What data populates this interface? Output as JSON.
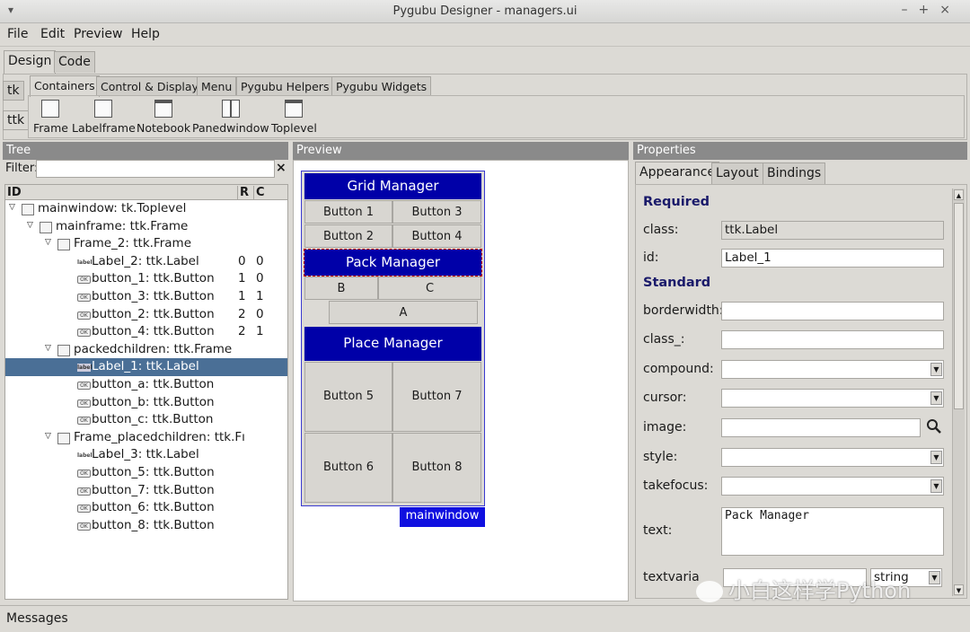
{
  "window": {
    "title": "Pygubu Designer - managers.ui",
    "controls": [
      "–",
      "+",
      "×"
    ]
  },
  "menu": [
    "File",
    "Edit",
    "Preview",
    "Help"
  ],
  "main_tabs": [
    "Design",
    "Code"
  ],
  "side_tabs": [
    "tk",
    "ttk"
  ],
  "palette_tabs": [
    "Containers",
    "Control & Display",
    "Menu",
    "Pygubu Helpers",
    "Pygubu Widgets"
  ],
  "palette_items": [
    "Frame",
    "Labelframe",
    "Notebook",
    "Panedwindow",
    "Toplevel"
  ],
  "panels": {
    "tree": "Tree",
    "preview": "Preview",
    "properties": "Properties"
  },
  "tree": {
    "filter_label": "Filter:",
    "filter_value": "",
    "clear": "×",
    "columns": {
      "id": "ID",
      "r": "R",
      "c": "C"
    },
    "rows": [
      {
        "label": "mainwindow: tk.Toplevel",
        "r": "",
        "c": "",
        "icon": "window-icon",
        "level": 0,
        "expander": "▽"
      },
      {
        "label": "mainframe: ttk.Frame",
        "r": "",
        "c": "",
        "icon": "frame-icon",
        "level": 1,
        "expander": "▽"
      },
      {
        "label": "Frame_2: ttk.Frame",
        "r": "",
        "c": "",
        "icon": "frame-icon",
        "level": 2,
        "expander": "▽"
      },
      {
        "label": "Label_2: ttk.Label",
        "r": "0",
        "c": "0",
        "icon": "label-icon",
        "level": 3,
        "expander": ""
      },
      {
        "label": "button_1: ttk.Button",
        "r": "1",
        "c": "0",
        "icon": "button-icon",
        "level": 3,
        "expander": ""
      },
      {
        "label": "button_3: ttk.Button",
        "r": "1",
        "c": "1",
        "icon": "button-icon",
        "level": 3,
        "expander": ""
      },
      {
        "label": "button_2: ttk.Button",
        "r": "2",
        "c": "0",
        "icon": "button-icon",
        "level": 3,
        "expander": ""
      },
      {
        "label": "button_4: ttk.Button",
        "r": "2",
        "c": "1",
        "icon": "button-icon",
        "level": 3,
        "expander": ""
      },
      {
        "label": "packedchildren: ttk.Frame",
        "r": "",
        "c": "",
        "icon": "frame-icon",
        "level": 2,
        "expander": "▽"
      },
      {
        "label": "Label_1: ttk.Label",
        "r": "",
        "c": "",
        "icon": "label-icon",
        "level": 3,
        "expander": "",
        "selected": true
      },
      {
        "label": "button_a: ttk.Button",
        "r": "",
        "c": "",
        "icon": "button-icon",
        "level": 3,
        "expander": ""
      },
      {
        "label": "button_b: ttk.Button",
        "r": "",
        "c": "",
        "icon": "button-icon",
        "level": 3,
        "expander": ""
      },
      {
        "label": "button_c: ttk.Button",
        "r": "",
        "c": "",
        "icon": "button-icon",
        "level": 3,
        "expander": ""
      },
      {
        "label": "Frame_placedchildren: ttk.Fı",
        "r": "",
        "c": "",
        "icon": "frame-icon",
        "level": 2,
        "expander": "▽"
      },
      {
        "label": "Label_3: ttk.Label",
        "r": "",
        "c": "",
        "icon": "label-icon",
        "level": 3,
        "expander": ""
      },
      {
        "label": "button_5: ttk.Button",
        "r": "",
        "c": "",
        "icon": "button-icon",
        "level": 3,
        "expander": ""
      },
      {
        "label": "button_7: ttk.Button",
        "r": "",
        "c": "",
        "icon": "button-icon",
        "level": 3,
        "expander": ""
      },
      {
        "label": "button_6: ttk.Button",
        "r": "",
        "c": "",
        "icon": "button-icon",
        "level": 3,
        "expander": ""
      },
      {
        "label": "button_8: ttk.Button",
        "r": "",
        "c": "",
        "icon": "button-icon",
        "level": 3,
        "expander": ""
      }
    ]
  },
  "preview": {
    "grid_title": "Grid Manager",
    "grid_buttons": [
      "Button 1",
      "Button 3",
      "Button 2",
      "Button 4"
    ],
    "pack_title": "Pack Manager",
    "pack_buttons": [
      "B",
      "C",
      "A"
    ],
    "place_title": "Place Manager",
    "place_buttons": [
      "Button 5",
      "Button 7",
      "Button 6",
      "Button 8"
    ],
    "window_tag": "mainwindow"
  },
  "properties": {
    "tabs": [
      "Appearance",
      "Layout",
      "Bindings"
    ],
    "required_title": "Required",
    "class_label": "class:",
    "class_value": "ttk.Label",
    "id_label": "id:",
    "id_value": "Label_1",
    "standard_title": "Standard",
    "fields": [
      {
        "label": "borderwidth:",
        "value": ""
      },
      {
        "label": "class_:",
        "value": ""
      },
      {
        "label": "compound:",
        "value": ""
      },
      {
        "label": "cursor:",
        "value": ""
      },
      {
        "label": "image:",
        "value": ""
      },
      {
        "label": "style:",
        "value": ""
      },
      {
        "label": "takefocus:",
        "value": ""
      }
    ],
    "text_label": "text:",
    "text_value": "Pack Manager",
    "textvariable_label": "textvaria",
    "textvariable_type": "string"
  },
  "statusbar": "Messages",
  "watermark": "小白这样学Python"
}
